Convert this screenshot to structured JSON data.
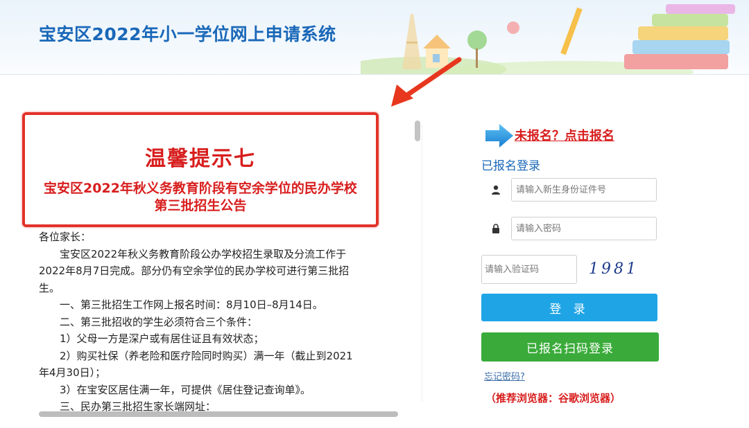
{
  "header": {
    "title": "宝安区2022年小一学位网上申请系统"
  },
  "notice": {
    "heading": "温馨提示七",
    "subtitle": "宝安区2022年秋义务教育阶段有空余学位的民办学校第三批招生公告",
    "body": [
      "各位家长：",
      "宝安区2022年秋义务教育阶段公办学校招生录取及分流工作于2022年8月7日完成。部分仍有空余学位的民办学校可进行第三批招生。",
      "一、第三批招生工作网上报名时间：8月10日–8月14日。",
      "二、第三批招收的学生必须符合三个条件：",
      "1）父母一方是深户或有居住证且有效状态；",
      "2）购买社保（养老险和医疗险同时购买）满一年（截止到2021年4月30日）；",
      "3）在宝安区居住满一年，可提供《居住登记查询单》。",
      "三、民办第三批招生家长端网址："
    ]
  },
  "login": {
    "register_link": "未报名？点击报名",
    "section_label": "已报名登录",
    "id_placeholder": "请输入新生身份证件号",
    "password_placeholder": "请输入密码",
    "captcha_placeholder": "请输入验证码",
    "captcha_code": "1981",
    "login_button": "登 录",
    "qr_login_button": "已报名扫码登录",
    "forgot_password": "忘记密码?",
    "browser_tip": "（推荐浏览器：谷歌浏览器）"
  },
  "icons": {
    "user": "user-icon",
    "lock": "lock-icon",
    "pointer": "blue-arrow-icon",
    "annotation": "red-arrow-icon"
  },
  "colors": {
    "title_blue": "#1a68b8",
    "alert_red": "#d81e1e",
    "login_blue": "#1fa5e6",
    "qr_green": "#3aab3a"
  }
}
